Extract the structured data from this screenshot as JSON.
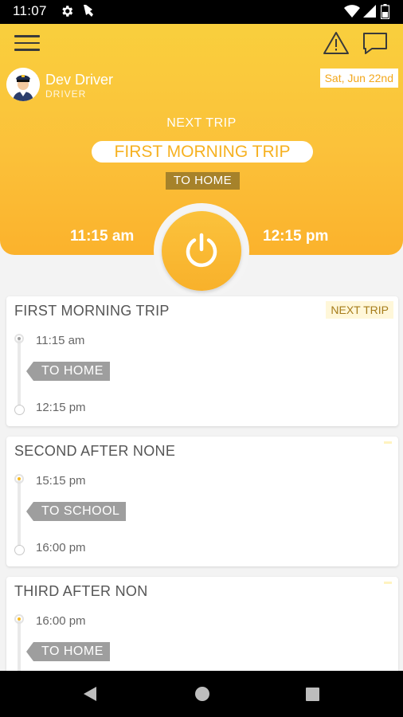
{
  "status_bar": {
    "time": "11:07",
    "icons": [
      "settings-icon",
      "notification-icon",
      "wifi-icon",
      "signal-icon",
      "battery-icon"
    ]
  },
  "header": {
    "driver_name": "Dev Driver",
    "driver_role": "DRIVER",
    "date": "Sat, Jun 22nd",
    "next_trip_label": "NEXT TRIP",
    "trip_name": "FIRST MORNING TRIP",
    "destination": "TO HOME",
    "start_time": "11:15 am",
    "end_time": "12:15 pm",
    "colors": {
      "accent": "#fbc13a",
      "tag": "#a6822a"
    }
  },
  "trips": [
    {
      "name": "FIRST MORNING TRIP",
      "badge": "NEXT TRIP",
      "start": "11:15 am",
      "destination": "TO HOME",
      "end": "12:15 pm",
      "dot_color": "#9e9e9e"
    },
    {
      "name": "SECOND AFTER NONE",
      "badge": "",
      "start": "15:15 pm",
      "destination": "TO SCHOOL",
      "end": "16:00 pm",
      "dot_color": "#f6b820"
    },
    {
      "name": "THIRD AFTER NON",
      "badge": "",
      "start": "16:00 pm",
      "destination": "TO HOME",
      "end": "",
      "dot_color": "#f6b820"
    }
  ]
}
